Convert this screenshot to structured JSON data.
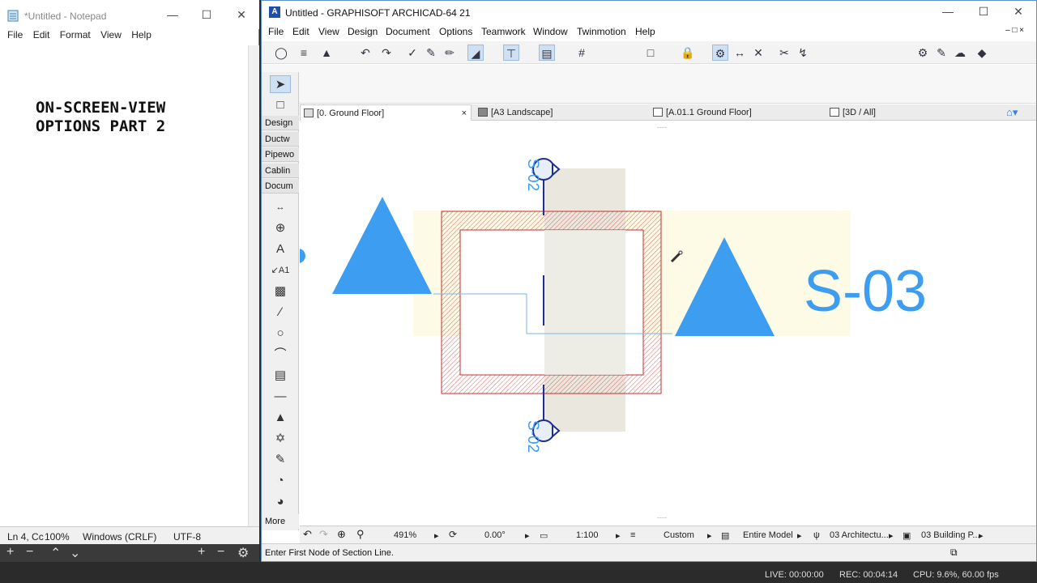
{
  "notepad": {
    "title": "*Untitled - Notepad",
    "menu": [
      "File",
      "Edit",
      "Format",
      "View",
      "Help"
    ],
    "text_line1": "ON-SCREEN-VIEW",
    "text_line2": "OPTIONS PART 2",
    "status": {
      "position": "Ln 4, Cc",
      "zoom": "100%",
      "eol": "Windows (CRLF)",
      "encoding": "UTF-8"
    }
  },
  "archicad": {
    "title": "Untitled - GRAPHISOFT ARCHICAD-64 21",
    "menu": [
      "File",
      "Edit",
      "View",
      "Design",
      "Document",
      "Options",
      "Teamwork",
      "Window",
      "Twinmotion",
      "Help"
    ],
    "toolbox_groups": [
      "Design",
      "Ductw",
      "Pipewo",
      "Cablin",
      "Docum"
    ],
    "toolbox_more": "More",
    "tabs": [
      {
        "label": "[0. Ground Floor]",
        "active": true
      },
      {
        "label": "[A3 Landscape]",
        "active": false
      },
      {
        "label": "[A.01.1 Ground Floor]",
        "active": false
      },
      {
        "label": "[3D / All]",
        "active": false
      }
    ],
    "canvas": {
      "section_label": "S-03",
      "marker_label": "S-02",
      "colors": {
        "marker_blue": "#3d9df0",
        "wall_red": "#d94040",
        "fill_beige": "#e9e7de",
        "fill_yellow": "#fdfbe6"
      }
    },
    "status": {
      "zoom": "491%",
      "angle": "0.00°",
      "scale": "1:100",
      "layer_combo": "Custom",
      "model_view": "Entire Model",
      "pen_set": "03 Architectu...",
      "mvo": "03 Building P..."
    },
    "prompt": "Enter First Node of Section Line."
  },
  "recorder": {
    "live": "LIVE: 00:00:00",
    "rec": "REC: 00:04:14",
    "cpu": "CPU: 9.6%, 60.00 fps"
  }
}
